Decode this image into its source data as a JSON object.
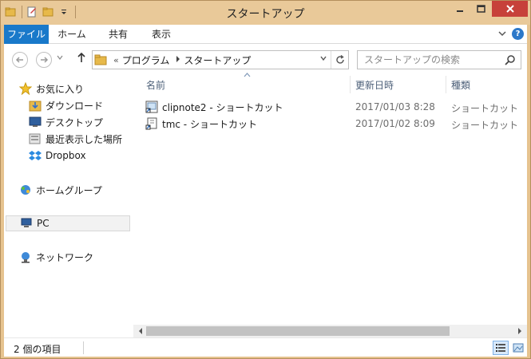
{
  "window": {
    "title": "スタートアップ"
  },
  "ribbon": {
    "tabs": [
      {
        "label": "ファイル"
      },
      {
        "label": "ホーム"
      },
      {
        "label": "共有"
      },
      {
        "label": "表示"
      }
    ]
  },
  "address": {
    "overflow": "«",
    "crumbs": [
      "プログラム",
      "スタートアップ"
    ]
  },
  "search": {
    "placeholder": "スタートアップの検索"
  },
  "nav": {
    "favorites": "お気に入り",
    "downloads": "ダウンロード",
    "desktop": "デスクトップ",
    "recent": "最近表示した場所",
    "dropbox": "Dropbox",
    "homegroup": "ホームグループ",
    "pc": "PC",
    "network": "ネットワーク"
  },
  "columns": {
    "name": "名前",
    "date": "更新日時",
    "type": "種類"
  },
  "files": [
    {
      "name": "clipnote2 - ショートカット",
      "date": "2017/01/03 8:28",
      "type": "ショートカット",
      "icon": "shortcut-icon"
    },
    {
      "name": "tmc - ショートカット",
      "date": "2017/01/02 8:09",
      "type": "ショートカット",
      "icon": "shortcut-icon"
    }
  ],
  "status": {
    "item_count": "2 個の項目"
  },
  "colors": {
    "accent": "#1979ca",
    "titlebar": "#e9c999",
    "close": "#c7413a"
  }
}
